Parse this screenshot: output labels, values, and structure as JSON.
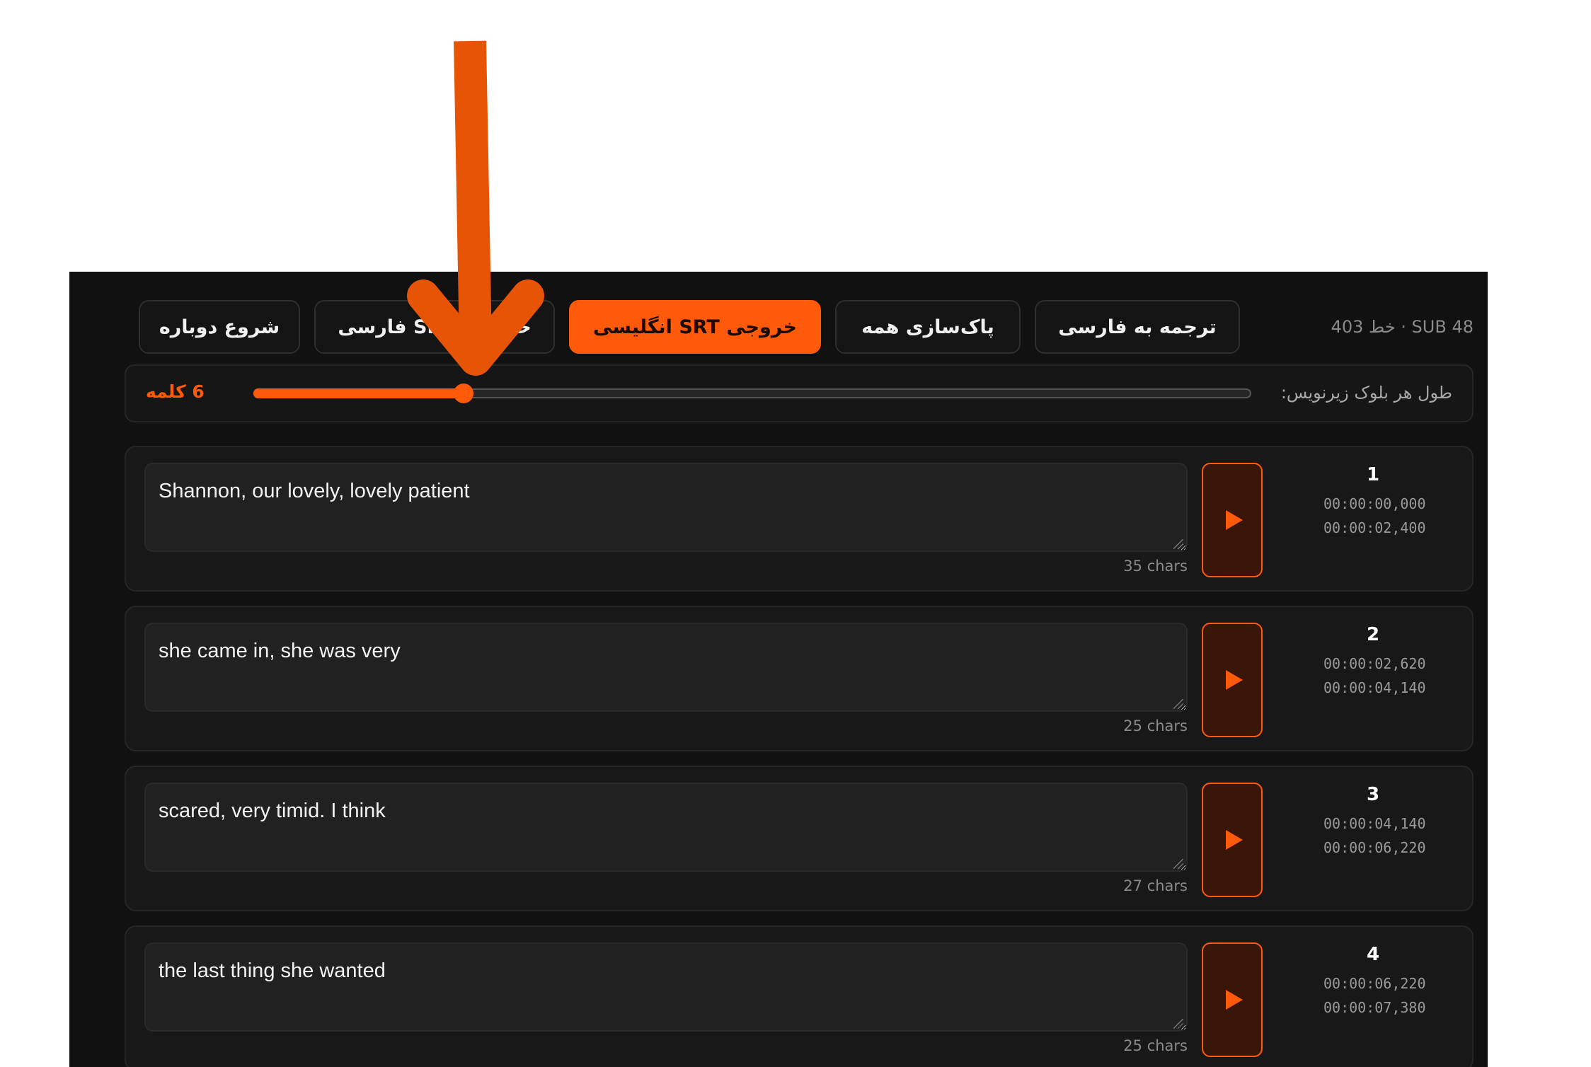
{
  "toolbar": {
    "stats": "403 خط · SUB 48",
    "buttons": [
      {
        "label": "ترجمه به فارسی",
        "primary": false
      },
      {
        "label": "پاک‌سازی همه",
        "primary": false
      },
      {
        "label": "خروجی SRT انگلیسی",
        "primary": true
      },
      {
        "label": "خروجی SRT فارسی",
        "primary": false
      },
      {
        "label": "شروع دوباره",
        "primary": false
      }
    ]
  },
  "slider": {
    "label": "طول هر بلوک زیرنویس:",
    "value_label": "6 کلمه",
    "fraction": 0.21
  },
  "cards": [
    {
      "index": "1",
      "start": "00:00:00,000",
      "end": "00:00:02,400",
      "text": "Shannon, our lovely, lovely patient",
      "chars": "35 chars"
    },
    {
      "index": "2",
      "start": "00:00:02,620",
      "end": "00:00:04,140",
      "text": "she came in, she was very",
      "chars": "25 chars"
    },
    {
      "index": "3",
      "start": "00:00:04,140",
      "end": "00:00:06,220",
      "text": "scared, very timid. I think",
      "chars": "27 chars"
    },
    {
      "index": "4",
      "start": "00:00:06,220",
      "end": "00:00:07,380",
      "text": "the last thing she wanted",
      "chars": "25 chars"
    }
  ],
  "colors": {
    "accent": "#ff5a0a",
    "arrow": "#e85406",
    "background": "#111111"
  },
  "icons": {
    "play": "play-icon",
    "annotation": "down-arrow-icon"
  }
}
